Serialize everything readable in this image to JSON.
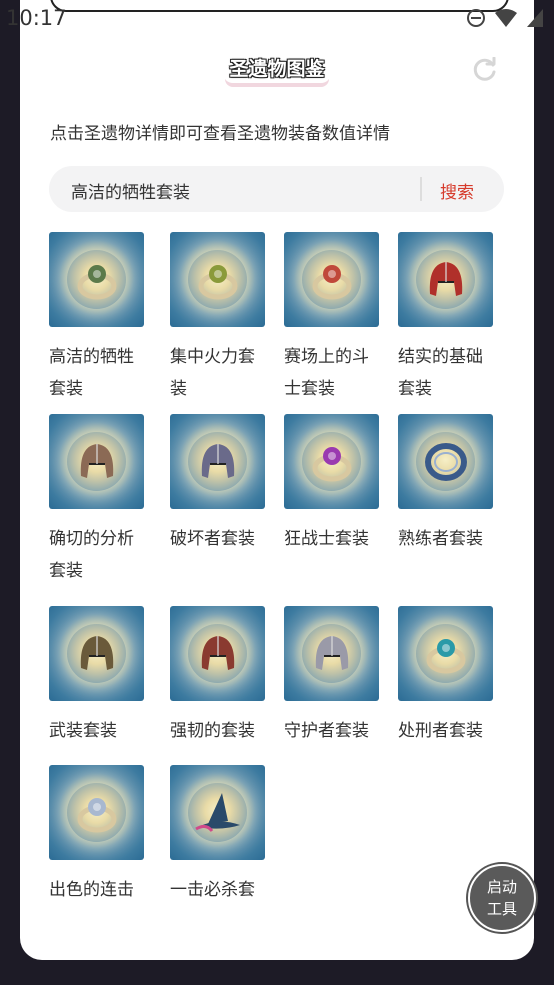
{
  "status": {
    "time": "10:17"
  },
  "header": {
    "title": "圣遗物图鉴"
  },
  "description": "点击圣遗物详情即可查看圣遗物装备数值详情",
  "search": {
    "value": "高洁的牺牲套装",
    "button_label": "搜索"
  },
  "items": [
    {
      "label": "高洁的牺牲套装",
      "icon": "crown-ring-icon",
      "color": "#5c7a4a"
    },
    {
      "label": "集中火力套装",
      "icon": "gem-ring-icon",
      "color": "#8a9a3a"
    },
    {
      "label": "赛场上的斗士套装",
      "icon": "ruby-ring-icon",
      "color": "#c0483a"
    },
    {
      "label": "结实的基础套装",
      "icon": "helmet-icon",
      "color": "#b0302a"
    },
    {
      "label": "确切的分析套装",
      "icon": "helmet-icon",
      "color": "#8b6a55"
    },
    {
      "label": "破坏者套装",
      "icon": "winged-helmet-icon",
      "color": "#6a6a8a"
    },
    {
      "label": "狂战士套装",
      "icon": "amethyst-ring-icon",
      "color": "#9a3ab0"
    },
    {
      "label": "熟练者套装",
      "icon": "coil-ring-icon",
      "color": "#3a5a8a"
    },
    {
      "label": "武装套装",
      "icon": "spiked-helmet-icon",
      "color": "#6a5a3a"
    },
    {
      "label": "强韧的套装",
      "icon": "helmet-icon",
      "color": "#8a3a30"
    },
    {
      "label": "守护者套装",
      "icon": "knight-helmet-icon",
      "color": "#9a9aa8"
    },
    {
      "label": "处刑者套装",
      "icon": "teal-ring-icon",
      "color": "#2a9aa8"
    },
    {
      "label": "出色的连击套装",
      "icon": "silver-ring-icon",
      "color": "#a8b8d0"
    },
    {
      "label": "一击必杀套装",
      "icon": "witch-hat-icon",
      "color": "#2a4a6a"
    }
  ],
  "float_button": {
    "line1": "启动",
    "line2": "工具"
  }
}
